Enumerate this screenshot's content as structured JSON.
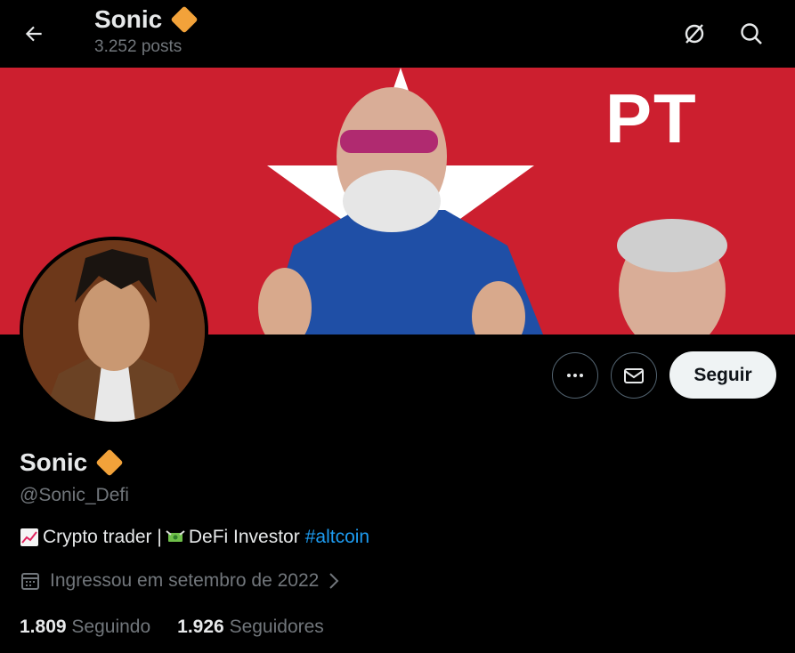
{
  "header": {
    "name": "Sonic",
    "posts_count": "3.252 posts",
    "icons": [
      "back-arrow-icon",
      "verified-diamond-icon",
      "grok-icon",
      "search-icon"
    ]
  },
  "banner": {
    "text": "PT",
    "background": "#cc1f2f"
  },
  "actions": {
    "more_icon": "more-icon",
    "message_icon": "envelope-icon",
    "follow_label": "Seguir"
  },
  "profile": {
    "name": "Sonic",
    "handle": "@Sonic_Defi",
    "bio": {
      "part1": "Crypto trader |",
      "part2": "DeFi Investor",
      "hashtag": "#altcoin"
    },
    "joined": "Ingressou em setembro de 2022",
    "following_count": "1.809",
    "following_label": "Seguindo",
    "followers_count": "1.926",
    "followers_label": "Seguidores"
  },
  "colors": {
    "accent": "#1d9bf0",
    "verified": "#f2a23a",
    "muted": "#71767b"
  }
}
